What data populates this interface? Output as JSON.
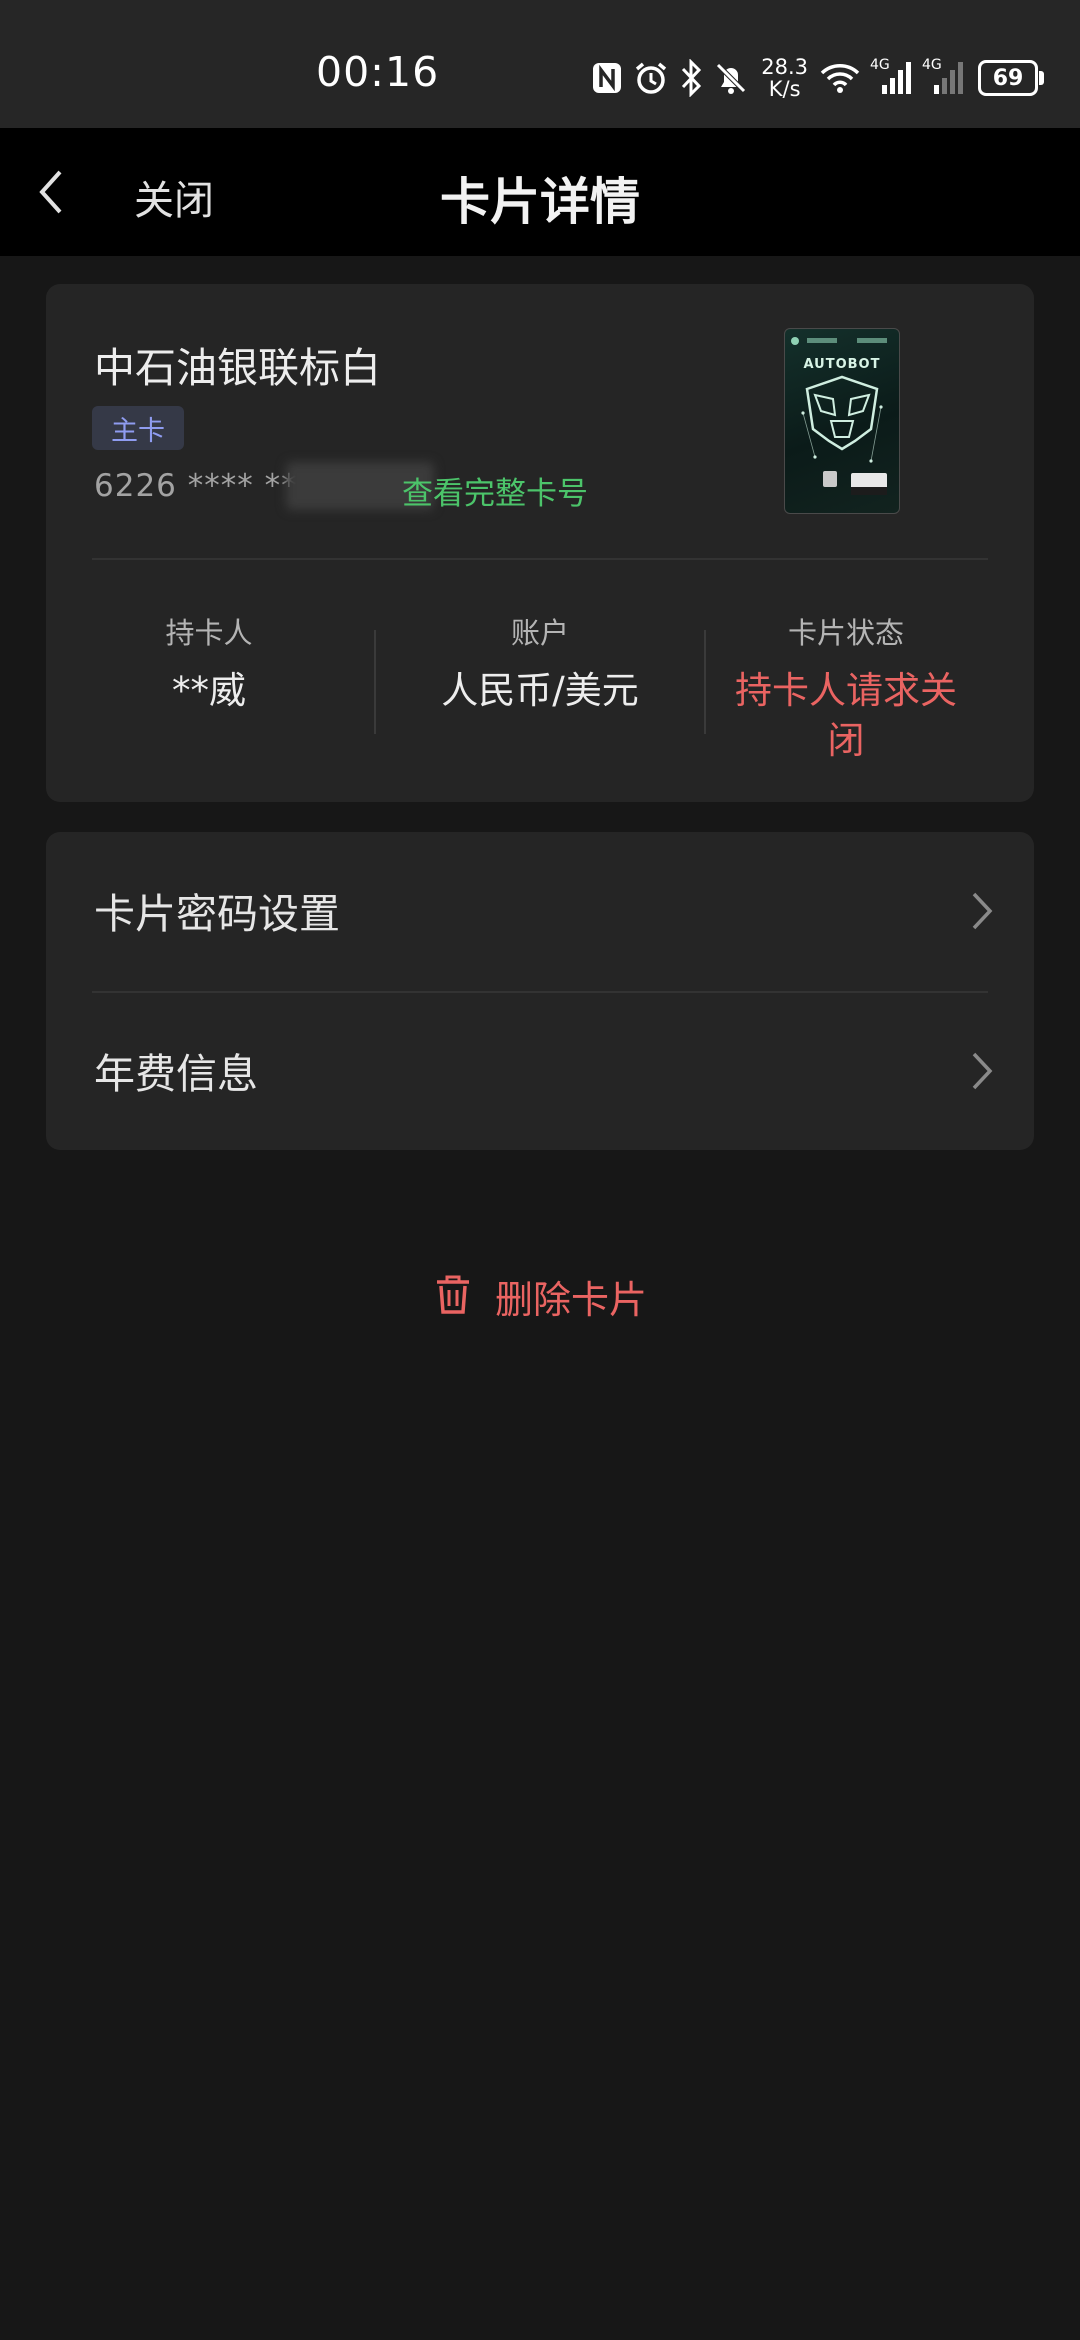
{
  "status_bar": {
    "time": "00:16",
    "net_speed_value": "28.3",
    "net_speed_unit": "K/s",
    "signal_1_label": "4G",
    "signal_2_label": "4G",
    "battery_level": "69",
    "icons": [
      "nfc-icon",
      "alarm-icon",
      "bluetooth-icon",
      "mute-bell-icon",
      "wifi-icon",
      "cell-signal-icon",
      "cell-signal-icon",
      "battery-icon"
    ]
  },
  "nav": {
    "back_icon": "chevron-left-icon",
    "close_label": "关闭",
    "title": "卡片详情"
  },
  "card": {
    "name": "中石油银联标白",
    "badge": "主卡",
    "number_masked": "6226 **** **",
    "view_full_label": "查看完整卡号",
    "image_brand_text": "AUTOBOT",
    "info": [
      {
        "label": "持卡人",
        "value": "**威",
        "color": "#ededed"
      },
      {
        "label": "账户",
        "value": "人民币/美元",
        "color": "#ededed"
      },
      {
        "label": "卡片状态",
        "value": "持卡人请求关闭",
        "color": "#ea6462"
      }
    ]
  },
  "settings": [
    {
      "label": "卡片密码设置",
      "icon": "chevron-right-icon"
    },
    {
      "label": "年费信息",
      "icon": "chevron-right-icon"
    }
  ],
  "delete": {
    "icon": "trash-icon",
    "label": "删除卡片",
    "color": "#ea6462"
  },
  "colors": {
    "background": "#171717",
    "panel": "#252525",
    "accent_green": "#4cc46a",
    "badge_text": "#8f9cf0",
    "danger": "#ea6462"
  }
}
